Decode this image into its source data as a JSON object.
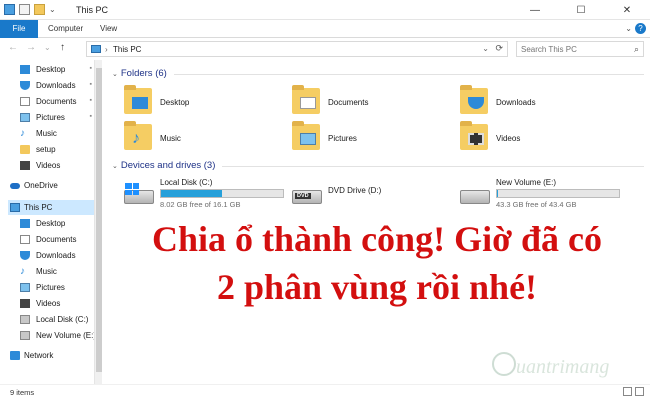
{
  "window": {
    "title": "This PC",
    "controls": {
      "minimize": "—",
      "maximize": "☐",
      "close": "✕"
    }
  },
  "ribbon": {
    "tabs": [
      "File",
      "Computer",
      "View"
    ],
    "help": "?",
    "collapse": "⌄"
  },
  "nav": {
    "back": "←",
    "forward": "→",
    "recent": "⌄",
    "up": "↑"
  },
  "address": {
    "chevron": "›",
    "path": "This PC",
    "dropdown": "⌄",
    "refresh": "⟳"
  },
  "search": {
    "placeholder": "Search This PC",
    "icon": "⌕"
  },
  "sidebar": {
    "pin": "📌",
    "quick": [
      {
        "label": "Desktop",
        "icon": "desktop-icon",
        "pinned": true
      },
      {
        "label": "Downloads",
        "icon": "downloads-icon",
        "pinned": true
      },
      {
        "label": "Documents",
        "icon": "documents-icon",
        "pinned": true
      },
      {
        "label": "Pictures",
        "icon": "pictures-icon",
        "pinned": true
      },
      {
        "label": "Music",
        "icon": "music-icon",
        "pinned": false
      },
      {
        "label": "setup",
        "icon": "folder-icon",
        "pinned": false
      },
      {
        "label": "Videos",
        "icon": "videos-icon",
        "pinned": false
      }
    ],
    "onedrive": "OneDrive",
    "thispc": "This PC",
    "pc_children": [
      {
        "label": "Desktop",
        "icon": "desktop-icon"
      },
      {
        "label": "Documents",
        "icon": "documents-icon"
      },
      {
        "label": "Downloads",
        "icon": "downloads-icon"
      },
      {
        "label": "Music",
        "icon": "music-icon"
      },
      {
        "label": "Pictures",
        "icon": "pictures-icon"
      },
      {
        "label": "Videos",
        "icon": "videos-icon"
      },
      {
        "label": "Local Disk (C:)",
        "icon": "drive-icon"
      },
      {
        "label": "New Volume (E:)",
        "icon": "drive-icon"
      }
    ],
    "network": "Network"
  },
  "folders": {
    "header": "Folders (6)",
    "items": [
      {
        "label": "Desktop",
        "icon": "desktop-folder-icon"
      },
      {
        "label": "Documents",
        "icon": "documents-folder-icon"
      },
      {
        "label": "Downloads",
        "icon": "downloads-folder-icon"
      },
      {
        "label": "Music",
        "icon": "music-folder-icon"
      },
      {
        "label": "Pictures",
        "icon": "pictures-folder-icon"
      },
      {
        "label": "Videos",
        "icon": "videos-folder-icon"
      }
    ]
  },
  "drives": {
    "header": "Devices and drives (3)",
    "items": [
      {
        "name": "Local Disk (C:)",
        "free": "8.02 GB free of 16.1 GB",
        "used_fraction": 0.5,
        "icon": "windows-drive-icon"
      },
      {
        "name": "DVD Drive (D:)",
        "free": "",
        "used_fraction": null,
        "icon": "dvd-drive-icon",
        "badge": "DVD"
      },
      {
        "name": "New Volume (E:)",
        "free": "43.3 GB free of 43.4 GB",
        "used_fraction": 0.003,
        "icon": "drive-icon"
      }
    ]
  },
  "status": {
    "items": "9 items"
  },
  "caption": {
    "line1": "Chia ổ thành công! Giờ đã có",
    "line2": "2 phân vùng rồi nhé!"
  },
  "watermark": {
    "text": "uantrimang",
    "letter": "Q"
  },
  "colors": {
    "accent": "#1979ca",
    "caption": "#d30f0f",
    "drive_bar": "#26a0da",
    "group_header": "#1e3287"
  }
}
